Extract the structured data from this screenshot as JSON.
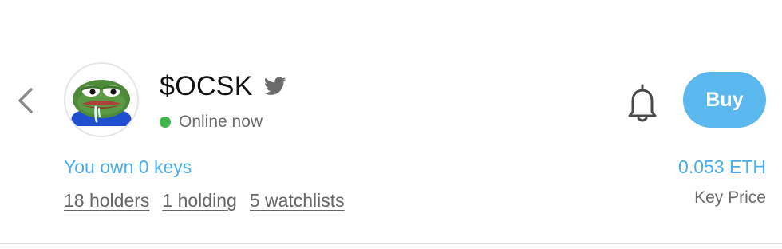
{
  "profile": {
    "name": "$OCSK",
    "status": "Online now",
    "status_color": "#3fb54a",
    "avatar_icon": "pepe-frog-avatar",
    "social_icon": "twitter-icon"
  },
  "actions": {
    "back_icon": "chevron-left-icon",
    "notify_icon": "bell-icon",
    "buy_label": "Buy",
    "buy_color": "#5ab8ee"
  },
  "ownership": {
    "text": "You own 0 keys"
  },
  "stats": {
    "holders": "18 holders",
    "holding": "1 holding",
    "watchlists": "5 watchlists"
  },
  "price": {
    "value": "0.053 ETH",
    "label": "Key Price"
  },
  "colors": {
    "accent": "#4aaeea",
    "muted_text": "#6b6b6b"
  }
}
